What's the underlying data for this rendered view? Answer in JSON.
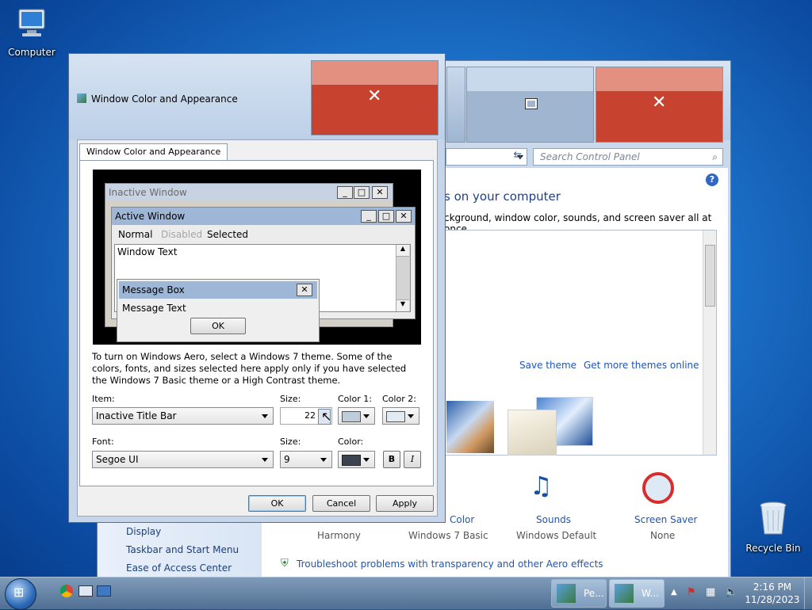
{
  "desktop": {
    "computer_label": "Computer",
    "recycle_label": "Recycle Bin"
  },
  "control_panel": {
    "search_placeholder": "Search Control Panel",
    "heading_partial": "s on your computer",
    "subtitle_partial": "ckground, window color, sounds, and screen saver all at once.",
    "save_theme": "Save theme",
    "get_more_themes": "Get more themes online",
    "sidebar_items": [
      "Display",
      "Taskbar and Start Menu",
      "Ease of Access Center"
    ],
    "bottom_items": [
      {
        "label": "Color",
        "value": "Windows 7 Basic"
      },
      {
        "label": "Sounds",
        "value": "Windows Default"
      },
      {
        "label": "Screen Saver",
        "value": "None"
      }
    ],
    "desktop_bg_value": "Harmony",
    "troubleshoot": "Troubleshoot problems with transparency and other Aero effects"
  },
  "dialog": {
    "title": "Window Color and Appearance",
    "tab_label": "Window Color and Appearance",
    "preview": {
      "inactive_title": "Inactive Window",
      "active_title": "Active Window",
      "menu_normal": "Normal",
      "menu_disabled": "Disabled",
      "menu_selected": "Selected",
      "window_text": "Window Text",
      "msgbox_title": "Message Box",
      "msgbox_text": "Message Text",
      "msgbox_ok": "OK"
    },
    "info_text": "To turn on Windows Aero, select a Windows 7 theme.  Some of the colors, fonts, and sizes selected here apply only if you have selected the Windows 7 Basic theme or a High Contrast theme.",
    "item_label": "Item:",
    "item_value": "Inactive Title Bar",
    "size_label": "Size:",
    "size_value": "22",
    "color1_label": "Color 1:",
    "color2_label": "Color 2:",
    "font_label": "Font:",
    "font_value": "Segoe UI",
    "font_size_label": "Size:",
    "font_size_value": "9",
    "font_color_label": "Color:",
    "bold_label": "B",
    "italic_label": "I",
    "ok": "OK",
    "cancel": "Cancel",
    "apply": "Apply"
  },
  "taskbar": {
    "task1": "Pe...",
    "task2": "W...",
    "time": "2:16 PM",
    "date": "11/28/2023"
  },
  "colors": {
    "close_red": "#c7432f",
    "title_active": "#9fb7d7",
    "link": "#1f55b5"
  }
}
